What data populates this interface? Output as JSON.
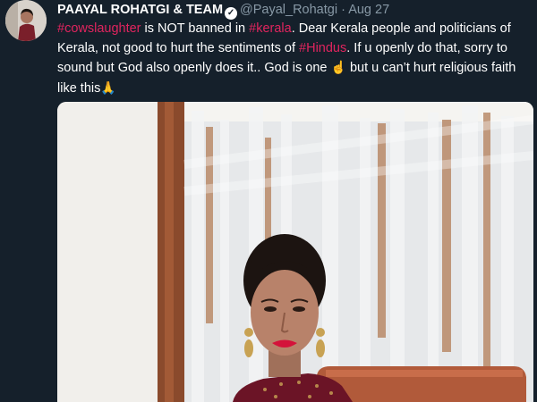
{
  "tweet": {
    "author_name": "PAAYAL ROHATGI & TEAM",
    "author_handle": "@Payal_Rohatgi",
    "separator": "·",
    "date": "Aug 27",
    "text": {
      "tag_cowslaughter": "#cowslaughter",
      "t1": " is NOT banned in ",
      "tag_kerala": "#kerala",
      "t2": ". Dear Kerala people and politicians of Kerala, not good to hurt the sentiments of ",
      "tag_hindus": "#Hindus",
      "t3": ". If u openly do that, sorry to sound but God also openly does it.. God is one ",
      "emoji_finger": "☝",
      "t4": " but u can’t hurt religious faith like this",
      "emoji_pray": "🙏"
    }
  },
  "colors": {
    "background": "#15202b",
    "hashtag": "#e0245e",
    "secondary_text": "#8899a6",
    "name_text": "#ffffff"
  },
  "icons": {
    "verified": "verified-badge-icon"
  }
}
